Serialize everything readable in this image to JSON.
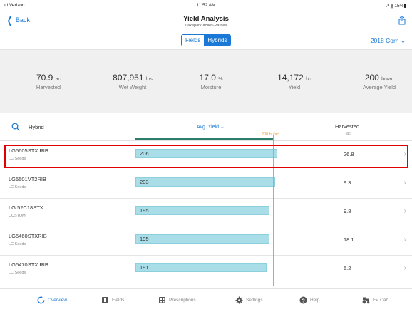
{
  "status": {
    "carrier": "ııl Verizon",
    "time": "11:52 AM",
    "battery": "↗ ∦ 15%▮"
  },
  "nav": {
    "back_label": "Back",
    "title": "Yield Analysis",
    "subtitle": "Lakepark-Itolies-Parnell"
  },
  "segments": {
    "fields": "Fields",
    "hybrids": "Hybrids"
  },
  "season": "2018 Corn ⌄",
  "summary": [
    {
      "value": "70.9",
      "unit": "ac",
      "label": "Harvested"
    },
    {
      "value": "807,951",
      "unit": "lbs",
      "label": "Wet Weight"
    },
    {
      "value": "17.0",
      "unit": "%",
      "label": "Moisture"
    },
    {
      "value": "14,172",
      "unit": "bu",
      "label": "Yield"
    },
    {
      "value": "200",
      "unit": "bu/ac",
      "label": "Average Yield"
    }
  ],
  "table_header": {
    "hybrid": "Hybrid",
    "avg_yield": "Avg. Yield ⌄",
    "avg_mark": "200 bu/ac",
    "harvested": "Harvested",
    "harvested_unit": "ac"
  },
  "rows": [
    {
      "name": "LG5605STX RIB",
      "brand": "LC Seeds",
      "yield": "206",
      "harvested": "26.8",
      "yield_num": 206
    },
    {
      "name": "LG5501VT2RIB",
      "brand": "LC Seeds",
      "yield": "203",
      "harvested": "9.3",
      "yield_num": 203
    },
    {
      "name": "LG 52C18STX",
      "brand": "CUSTOM",
      "yield": "195",
      "harvested": "9.8",
      "yield_num": 195
    },
    {
      "name": "LG5460STXRIB",
      "brand": "LC Seeds",
      "yield": "195",
      "harvested": "18.1",
      "yield_num": 195
    },
    {
      "name": "LG5470STX RIB",
      "brand": "LC Seeds",
      "yield": "191",
      "harvested": "5.2",
      "yield_num": 191
    }
  ],
  "tabs": [
    {
      "label": "Overview",
      "active": true
    },
    {
      "label": "Fields",
      "active": false
    },
    {
      "label": "Prescriptions",
      "active": false
    },
    {
      "label": "Settings",
      "active": false
    },
    {
      "label": "Help",
      "active": false
    },
    {
      "label": "FV Cab",
      "active": false
    }
  ],
  "colors": {
    "accent": "#1a78d6",
    "bar": "#a9dde8",
    "avg_line": "#f0a030",
    "highlight": "#e00000"
  }
}
